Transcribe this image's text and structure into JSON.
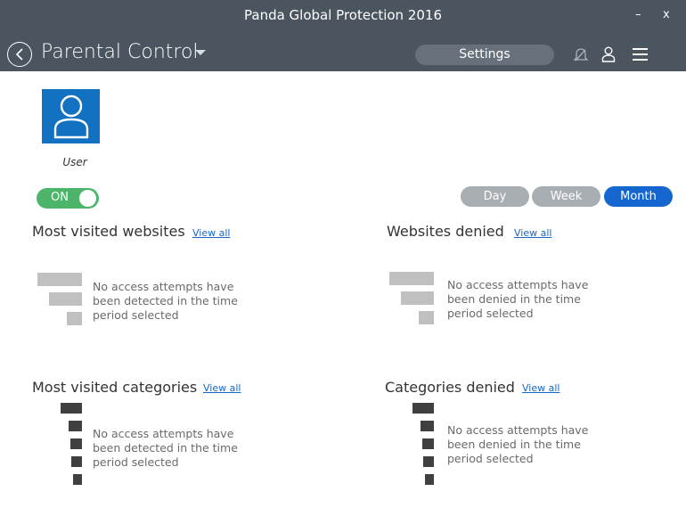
{
  "window": {
    "title": "Panda Global Protection 2016",
    "minimize": "–",
    "close": "x"
  },
  "header": {
    "page_title": "Parental Control",
    "settings_label": "Settings"
  },
  "profile": {
    "name": "User",
    "toggle_state": "ON"
  },
  "period": {
    "options": [
      "Day",
      "Week",
      "Month"
    ],
    "selected": "Month"
  },
  "sections": {
    "most_visited_websites": {
      "title": "Most visited websites",
      "view_all": "View all",
      "message": "No access attempts have been detected in the time period selected"
    },
    "websites_denied": {
      "title": "Websites denied",
      "view_all": "View all",
      "message": "No access attempts have been denied in the time period selected"
    },
    "most_visited_categories": {
      "title": "Most visited categories",
      "view_all": "View all",
      "message": "No access attempts have been detected in the time period selected"
    },
    "categories_denied": {
      "title": "Categories denied",
      "view_all": "View all",
      "message": "No access attempts have been denied in the time period selected"
    }
  },
  "colors": {
    "header_bg": "#4a5560",
    "accent_blue": "#1567cf",
    "toggle_green": "#4cb56a",
    "placeholder_light": "#c0c0c0",
    "placeholder_dark": "#404040"
  }
}
